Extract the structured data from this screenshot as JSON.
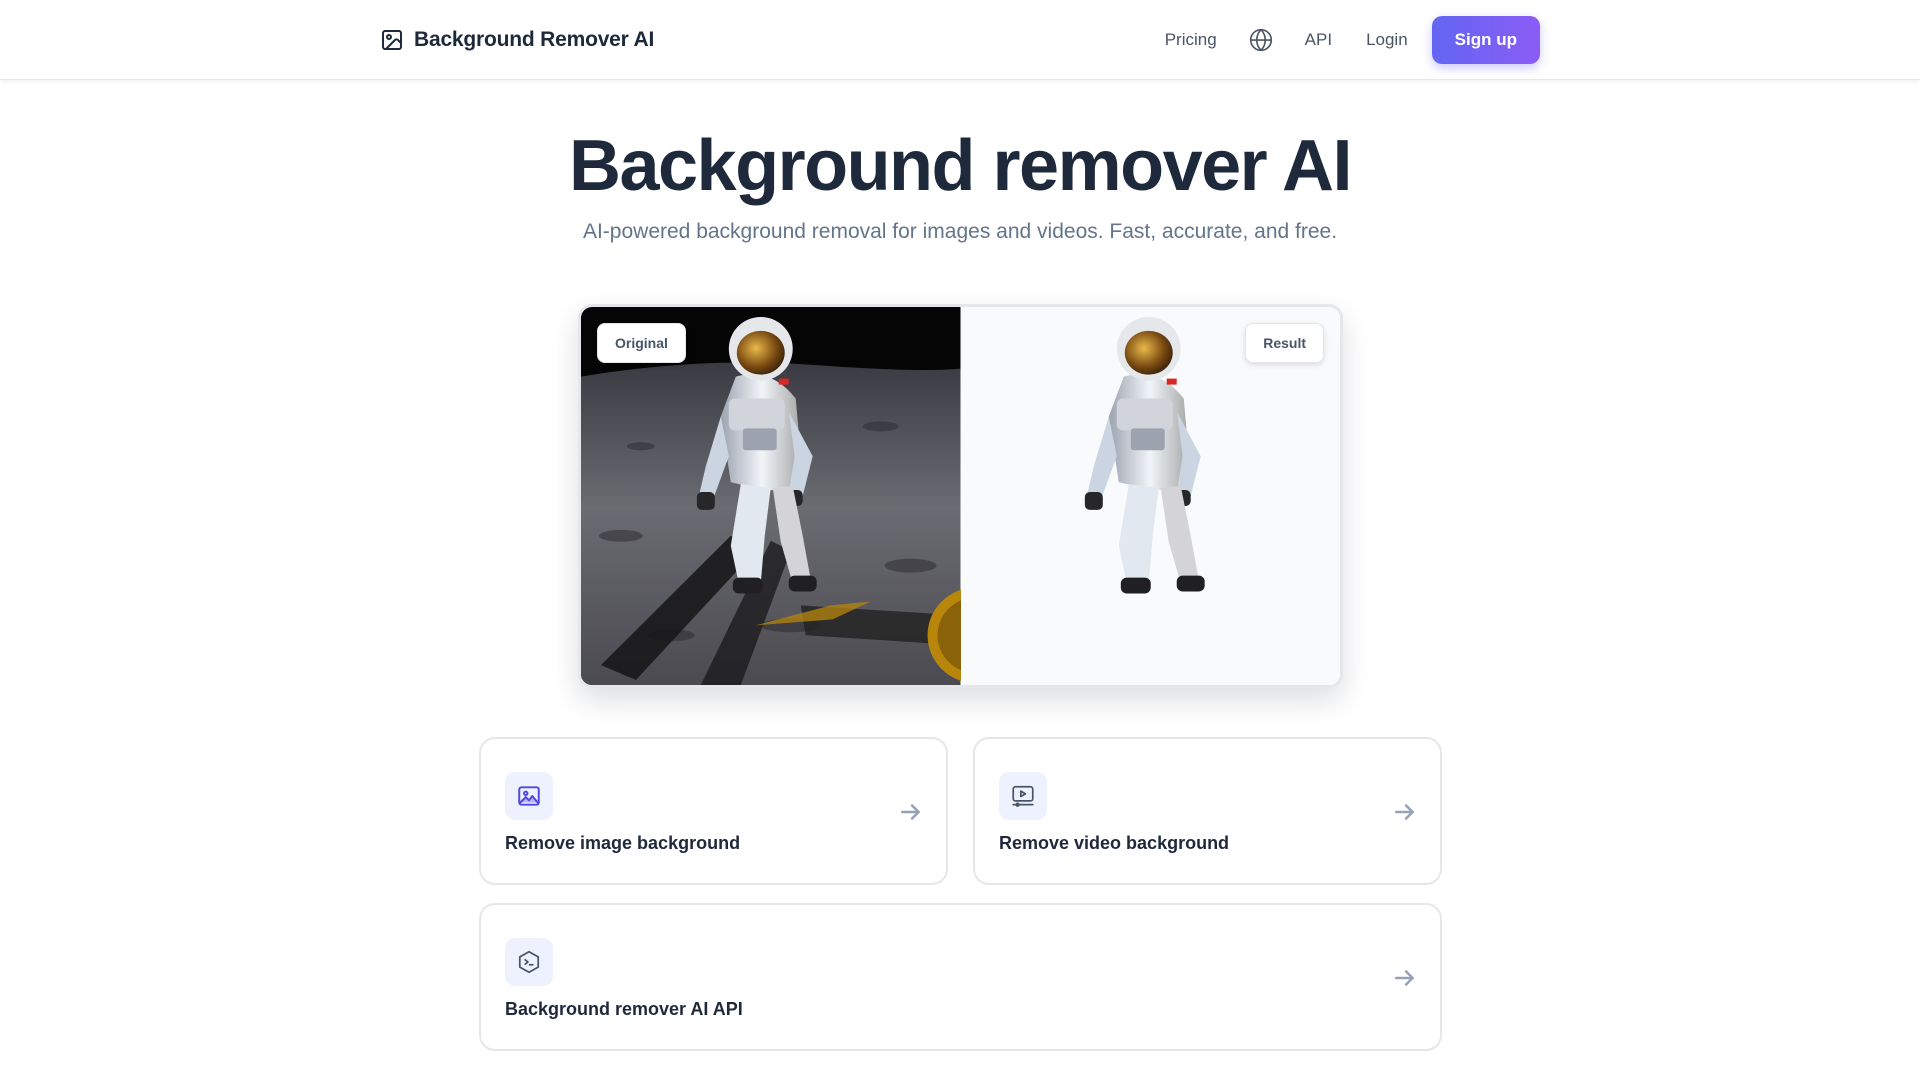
{
  "header": {
    "brand_name": "Background Remover AI",
    "brand_icon": "image-icon",
    "nav": {
      "pricing": "Pricing",
      "language_icon": "globe-icon",
      "api": "API",
      "login": "Login",
      "signup": "Sign up"
    }
  },
  "hero": {
    "title": "Background remover AI",
    "subtitle": "AI-powered background removal for images and videos. Fast, accurate, and free."
  },
  "comparison": {
    "original_label": "Original",
    "result_label": "Result"
  },
  "cards": [
    {
      "label": "Remove image background",
      "icon": "image-icon"
    },
    {
      "label": "Remove video background",
      "icon": "video-play-icon"
    },
    {
      "label": "Background remover AI API",
      "icon": "code-terminal-icon"
    }
  ],
  "colors": {
    "accent_start": "#6366f1",
    "accent_end": "#8b5cf6",
    "text_primary": "#1e293b",
    "text_muted": "#64748b",
    "icon_tint": "#4f46e5",
    "icon_bg": "#eef2ff"
  }
}
